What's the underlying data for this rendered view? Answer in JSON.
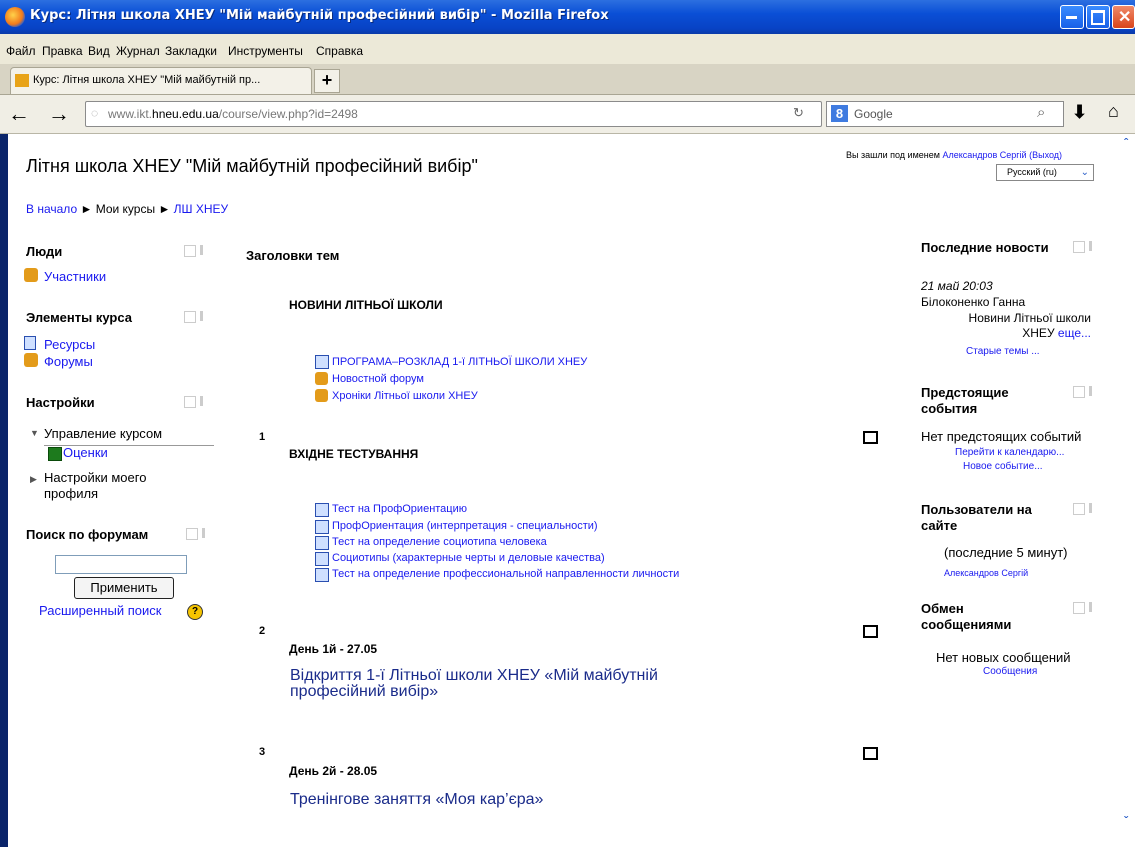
{
  "window": {
    "title": "Курс: Літня школа ХНЕУ \"Мій майбутній професійний вибір\" - Mozilla Firefox"
  },
  "menu": [
    "Файл",
    "Правка",
    "Вид",
    "Журнал",
    "Закладки",
    "Инструменты",
    "Справка"
  ],
  "tab": {
    "title": "Курс: Літня школа ХНЕУ \"Мій майбутній пр...",
    "new_tab": "+"
  },
  "nav": {
    "url_prefix": "www.ikt.",
    "url_domain": "hneu.edu.ua",
    "url_path": "/course/view.php?id=2498",
    "search_engine": "8",
    "search_placeholder": "Google"
  },
  "header": {
    "course_title": "Літня школа ХНЕУ \"Мій майбутній професійний вибір\"",
    "logged_in_prefix": "Вы зашли под именем",
    "user_name": "Александров Сергій",
    "logout": "(Выход)",
    "language": "Русский (ru)"
  },
  "breadcrumb": {
    "home": "В начало",
    "sep": "►",
    "my_courses": "Мои курсы",
    "course": "ЛШ ХНЕУ"
  },
  "left": {
    "people_title": "Люди",
    "participants": "Участники",
    "elements_title": "Элементы курса",
    "resources": "Ресурсы",
    "forums": "Форумы",
    "settings_title": "Настройки",
    "course_admin": "Управление курсом",
    "grades": "Оценки",
    "profile_line1": "Настройки моего",
    "profile_line2": "профиля",
    "search_title": "Поиск по форумам",
    "apply": "Применить",
    "advanced_search": "Расширенный поиск",
    "help": "?"
  },
  "main": {
    "topics_title": "Заголовки тем",
    "section0_title": "НОВИНИ ЛІТНЬОЇ ШКОЛИ",
    "section0_items": [
      "ПРОГРАМА–РОЗКЛАД 1-ї ЛІТНЬОЇ ШКОЛИ ХНЕУ",
      "Новостной форум",
      "Хроніки Літньої школи ХНЕУ"
    ],
    "section1_num": "1",
    "section1_title": "ВХІДНЕ ТЕСТУВАННЯ",
    "section1_items": [
      "Тест на ПрофОриентацию",
      "ПрофОриентация (интерпретация - специальности)",
      "Тест на определение социотипа человека",
      "Социотипы (характерные черты и деловые качества)",
      "Тест на определение профессиональной направленности личности"
    ],
    "section2_num": "2",
    "section2_day": "День 1й - 27.05",
    "section2_line1": "Відкриття 1-ї Літньої школи ХНЕУ «Мій майбутній",
    "section2_line2": "професійний вибір»",
    "section3_num": "3",
    "section3_day": "День 2й - 28.05",
    "section3_title": "Тренінгове заняття «Моя кар’єра»"
  },
  "right": {
    "news_title": "Последние новости",
    "news_date": "21 май 20:03",
    "news_author": "Білоконенко Ганна",
    "news_line1": "Новини Літньої школи",
    "news_line2": "ХНЕУ",
    "news_more": "еще...",
    "old_topics": "Старые темы ...",
    "events_title1": "Предстоящие",
    "events_title2": "события",
    "no_events": "Нет предстоящих событий",
    "calendar": "Перейти к календарю...",
    "new_event": "Новое событие...",
    "users_title1": "Пользователи на",
    "users_title2": "сайте",
    "users_last": "(последние 5 минут)",
    "users_name": "Александров Сергій",
    "messages_title1": "Обмен",
    "messages_title2": "сообщениями",
    "no_messages": "Нет новых сообщений",
    "messages_link": "Сообщения"
  }
}
